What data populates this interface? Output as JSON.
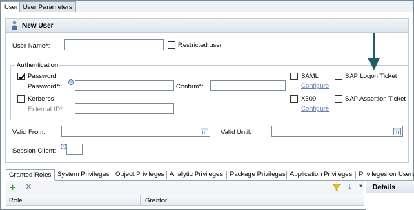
{
  "top_tabs": [
    "User",
    "User Parameters"
  ],
  "panel_title": "New User",
  "form": {
    "user_name_label": "User Name*:",
    "restricted_user_label": "Restricted user",
    "authentication_label": "Authentication",
    "password_label": "Password",
    "password_field_label": "Password*:",
    "confirm_label": "Confirm*:",
    "kerberos_label": "Kerberos",
    "external_id_label": "External ID*:",
    "saml_label": "SAML",
    "saml_configure": "Configure",
    "x509_label": "X509",
    "x509_configure": "Configure",
    "sap_logon_ticket_label": "SAP Logon Ticket",
    "sap_assertion_ticket_label": "SAP Assertion Ticket",
    "valid_from_label": "Valid From:",
    "valid_until_label": "Valid Until:",
    "session_client_label": "Session Client:",
    "password_checked": true,
    "info_glyph": "i"
  },
  "bottom_tabs": [
    "Granted Roles",
    "System Privileges",
    "Object Privileges",
    "Analytic Privileges",
    "Package Privileges",
    "Application Privileges",
    "Privileges on Users"
  ],
  "toolbar": {
    "add_glyph": "+",
    "remove_glyph": "×",
    "sort_glyph": "↓",
    "dropdown_glyph": "▼"
  },
  "table": {
    "columns": [
      "Role",
      "Grantor"
    ]
  },
  "details_title": "Details",
  "arrow_color": "#1f5c63",
  "icons": [
    "user-icon",
    "info-icon",
    "calendar-icon",
    "add-icon",
    "remove-icon",
    "filter-icon",
    "sort-icon",
    "dropdown-icon",
    "arrow-pointer"
  ]
}
